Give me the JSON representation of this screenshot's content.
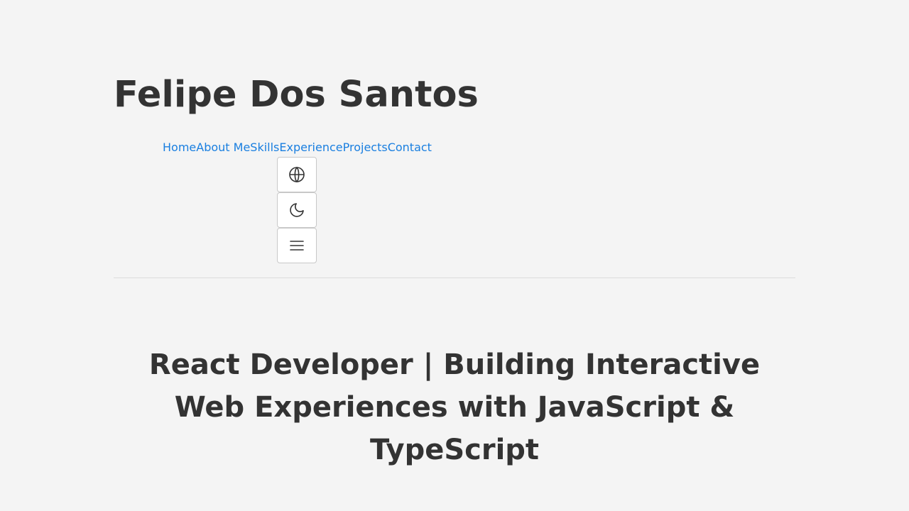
{
  "header": {
    "site_title": "Felipe Dos Santos",
    "nav": {
      "items": [
        {
          "label": "Home"
        },
        {
          "label": "About Me"
        },
        {
          "label": "Skills"
        },
        {
          "label": "Experience"
        },
        {
          "label": "Projects"
        },
        {
          "label": "Contact"
        }
      ]
    },
    "controls": {
      "language_icon": "globe-icon",
      "theme_icon": "moon-icon",
      "menu_icon": "hamburger-menu-icon"
    }
  },
  "hero": {
    "headline": "React Developer | Building Interactive Web Experiences with JavaScript & TypeScript"
  },
  "colors": {
    "background": "#f4f4f4",
    "text": "#333333",
    "link": "#1a7fe0",
    "divider": "#dcdcdc"
  }
}
